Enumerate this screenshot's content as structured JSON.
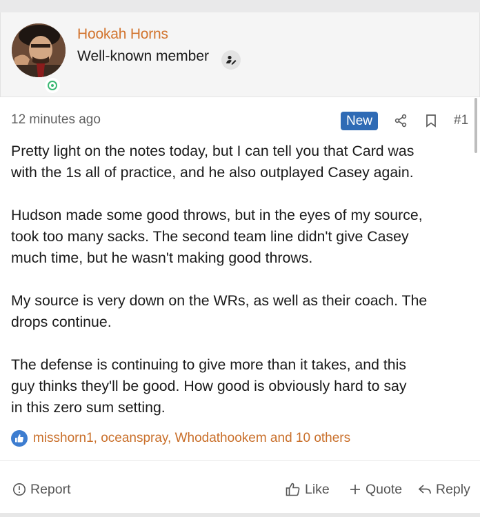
{
  "user": {
    "name": "Hookah Horns",
    "title": "Well-known member"
  },
  "post": {
    "time_ago": "12 minutes ago",
    "new_label": "New",
    "number": "#1",
    "paragraphs": [
      "Pretty light on the notes today, but I can tell you that Card was\nwith the 1s all of practice, and he also outplayed Casey again.",
      "Hudson made some good throws, but in the eyes of my source,\ntook too many sacks. The second team line didn't give Casey\nmuch time, but he wasn't making good throws.",
      "My source is very down on the WRs, as well as their coach. The\ndrops continue.",
      "The defense is continuing to give more than it takes, and this\nguy thinks they'll be good. How good is obviously hard to say\nin this zero sum setting."
    ],
    "reactions_text": "misshorn1, oceanspray, Whodathookem and 10 others"
  },
  "actions": {
    "report": "Report",
    "like": "Like",
    "quote": "Quote",
    "reply": "Reply"
  },
  "colors": {
    "username": "#d2742e",
    "new_badge": "#2f6bb5",
    "reaction_link": "#c96f2a",
    "online_status": "#3bb873"
  },
  "icons": {
    "title_badge": "user-edit-icon",
    "share": "share-icon",
    "bookmark": "bookmark-icon",
    "like_reaction": "thumbs-up-icon",
    "report": "alert-circle-icon",
    "like": "thumbs-up-outline-icon",
    "quote": "plus-icon",
    "reply": "reply-arrow-icon"
  }
}
